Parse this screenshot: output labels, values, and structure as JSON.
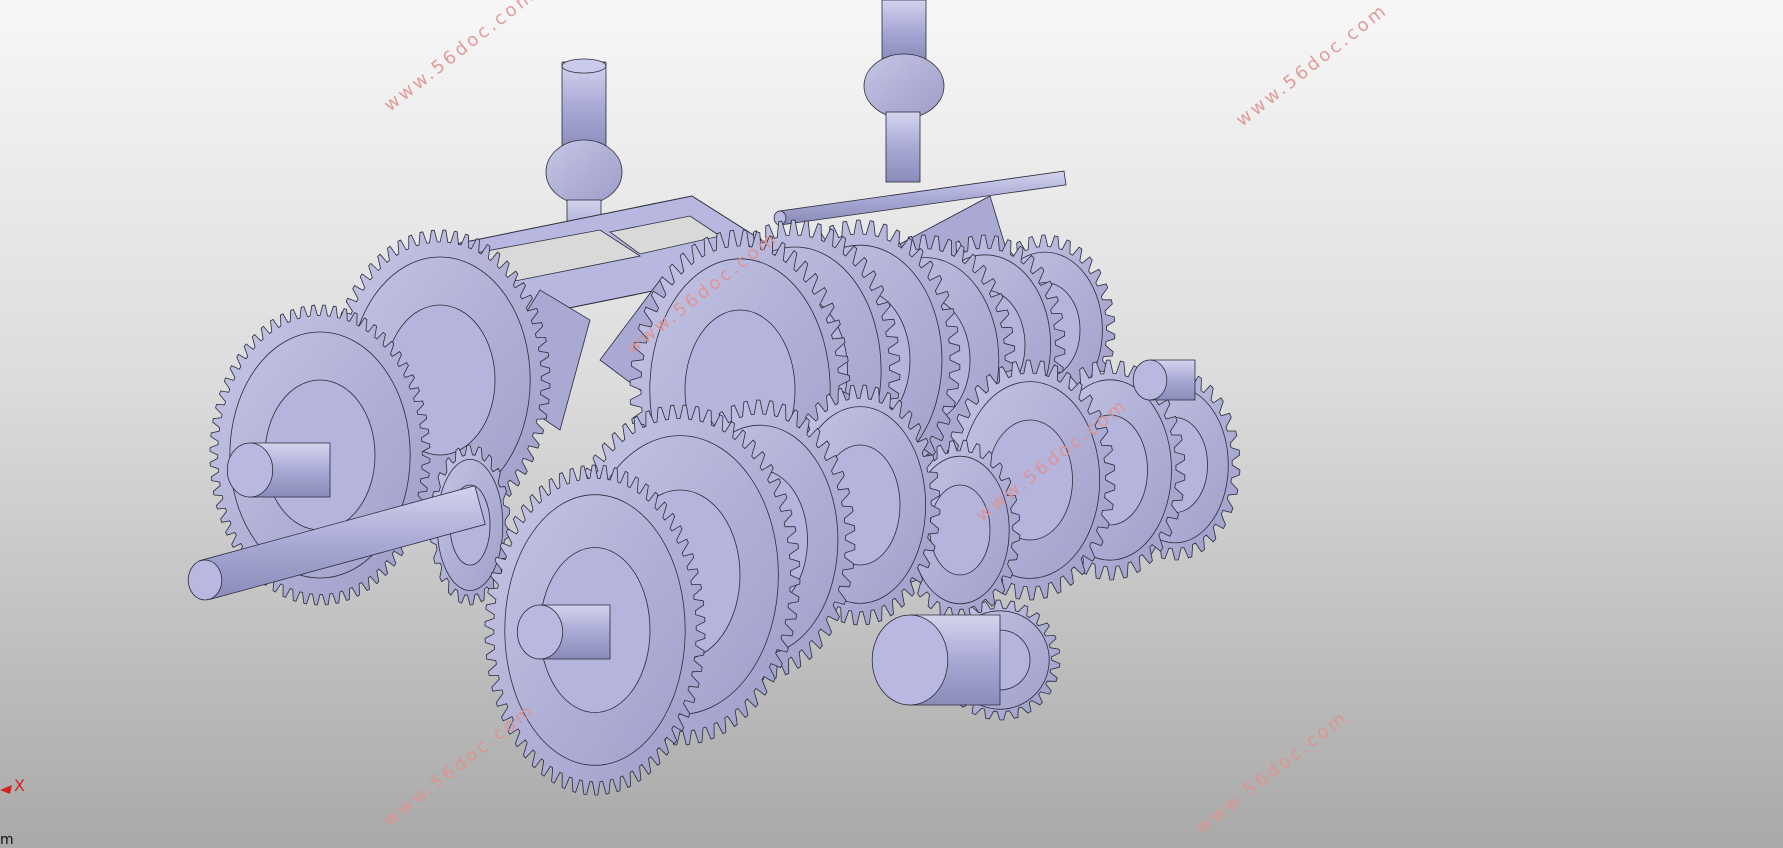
{
  "viewport": {
    "background_top": "#f7f7f7",
    "background_bottom": "#a9a9a9",
    "model_color": "#aaaad4",
    "edge_color": "#2b2b3c"
  },
  "watermarks": [
    "www.56doc.com",
    "www.56doc.com",
    "www.56doc.com",
    "www.56doc.com",
    "www.56doc.com",
    "www.56doc.com"
  ],
  "watermark_color": "#e0928f",
  "triad": {
    "x_label": "X",
    "icon": "axis-triad-icon",
    "color": "#d32222"
  },
  "scale_text": "m"
}
